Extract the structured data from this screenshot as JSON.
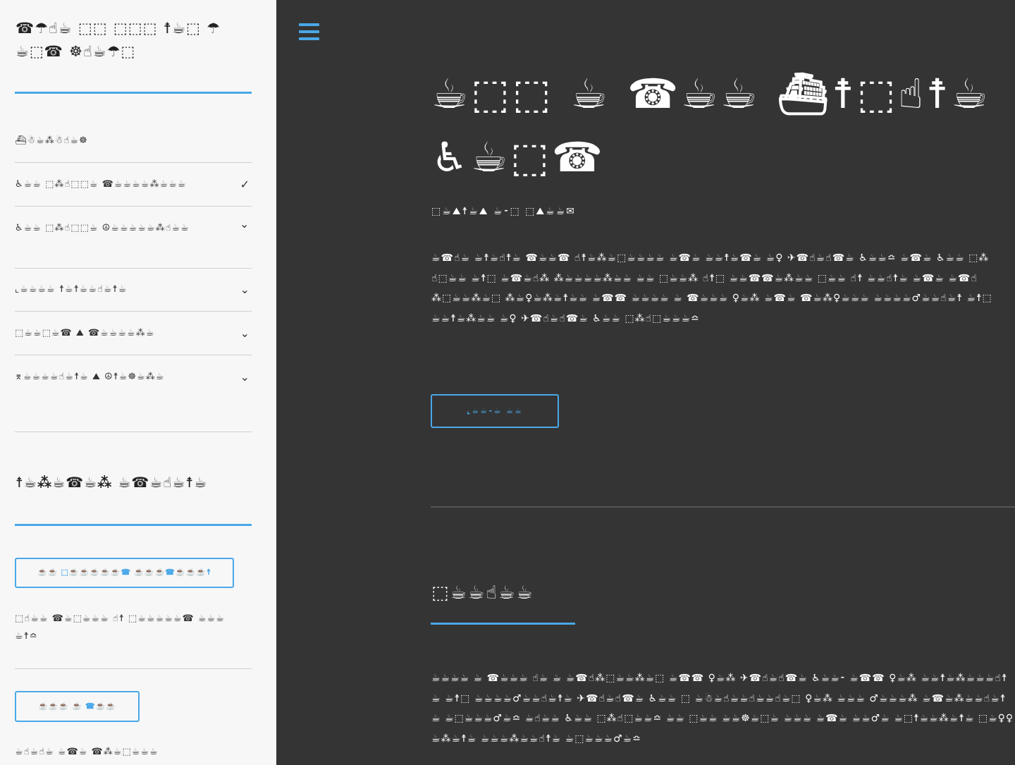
{
  "sidebar": {
    "title": "☎☂☝☕ ⬚⬚ ⬚⬚⬚ ☨☕⬚ ☂☕⬚☎ ☸☝☕☂⬚",
    "nav_items": [
      {
        "label": "⛴☃☕⁂☃☝☕☸"
      },
      {
        "label": "♿☕☕ ⬚⁂☝⬚⬚☕ ☎☕☕☕☕⁂☕☕☕",
        "chevron": "✓"
      },
      {
        "label": "♿☕☕ ⬚⁂☝⬚⬚☕ ☮☕☕☕☕☕⁂☝☕☕",
        "chevron": "⌄"
      },
      {
        "label": "⌞☕☕☕☕ ☨☕☨☕☕☝☕☨☕",
        "chevron": "⌄"
      },
      {
        "label": "⬚☕☕⬚☕☎ ⛰ ☎☕☕☕☕⁂☕",
        "chevron": "⌄"
      },
      {
        "label": "⌆☕☕☕☕☝☕☨☕ ⛰ ☮☨☕☸☕⁂☕",
        "chevron": "⌄"
      }
    ],
    "subtitle": "☨☕⁂☕☎☕⁂ ☕☎☕☝☕☨☕",
    "primary_button": "☕☕ ⬚☕☕☕☕☕☎ ☕☕☕☎☕☕☕☨",
    "text1": "⬚☝☕☕ ☎☕⬚☕☕☕ ☝☨ ⬚☕☕☕☕☕☎ ☕☕☕☕☨≏",
    "secondary_button": "☕☕☕ ☕ ☎☕☕",
    "text2": "☕☝☕☝☕ ☕☎☕ ☎⁂☕⬚☕☕☕"
  },
  "hero": {
    "title": "☕⬚⬚ ☕ ☎☕☕ ⛴☨⬚☝☨☕ ♿☕⬚☎",
    "subtitle": "⬚☕⛰☨☕⛰ ☕⁃⬚ ⬚⛰☕☕✉",
    "body": "☕☎☝☕ ☕☨☕☝☨☕ ☎☕☕☎ ☝☨☕⁂☕⬚☕☕☕☕ ☕☎☕ ☕☕☨☕☎☕ ☕♀ ✈☎☝☕☝☎☕ ♿☕☕≏ ☕☎☕ ♿☕☕ ⬚⁂☝⬚☕☕ ☕☨⬚ ☕☎☕☝⁂ ⁂☕☕☕☕⁂☕☕ ☕☕ ⬚☕☕⁂ ☝☨⬚ ☕☕☎☎☕⁂☕☕ ⬚☕☕ ☝☨ ☕☕☝☨☕ ☕☎☕ ☕☎☝⁂⬚☕☕⁂☕⬚ ⁂☕♀☕⁂☕☨☕☕ ☕☎☎ ☕☕☕☕ ☕ ☎☕☕☕ ♀☕⁂ ☕☎☕ ☎☕⁂♀☕☕☕ ☕☕☕☕♂☕☕☝☕☨ ☕☨⬚ ☕☕☨☕⁂☕☕ ☕♀ ✈☎☝☕☝☎☕ ♿☕☕ ⬚⁂☝⬚☕☕☕≏",
    "button": "⌞☕☕⁃☕ ☕☕"
  },
  "section": {
    "title": "⬚☕☕☝☕☕",
    "body": "☕☕☕☕ ☕ ☎☕☕☕ ☝☕ ☕ ☕☎☝⁂⬚☕☕⁂☕⬚ ☕☎☎ ♀☕⁂ ✈☎☝☕☝☎☕ ♿☕☕⁃ ☕☎☎ ♀☕⁂ ☕☕☨☕⁂☕☕☕☝☨☕ ☕☨⬚ ☕☕☕☕♂☕☕☝☕☨☕ ✈☎☝☕☝☎☕ ♿☕☕ ⬚ ☕☃☕☝☕☕☝☕☕☝☕⬚ ♀☕⁂ ☕☕☕ ♂☕☕☕⁂ ☕☎☕⁂☕☕☝☕☨☕ ☕⬚☕☕☕♂☕≏ ☕☝☕☕ ♿☕☕ ⬚⁂☝⬚☕☕≏ ☕☕ ⬚☕☕ ☕☕☸☕⬚☕ ☕☕☕ ☕☎☕ ☕☕♂☕ ☕⬚☨☕☕⁂☕☨☕ ⬚☕♀♀☕⁂☕☨☕ ☕☕☕⁂☕☕☝☨☕ ☕⬚☕☕☕♂☕≏"
  },
  "colors": {
    "accent": "#4aa8e8",
    "main_background": "#343434",
    "sidebar_background": "#f7f7f7"
  }
}
